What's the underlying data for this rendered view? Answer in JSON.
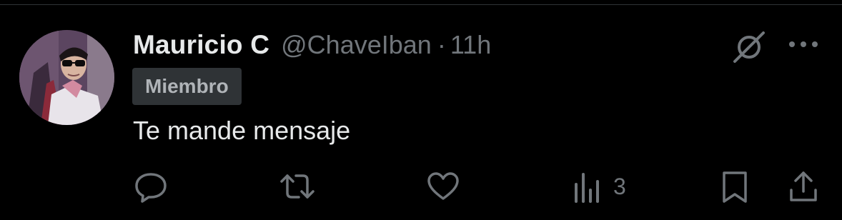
{
  "tweet": {
    "display_name": "Mauricio C",
    "handle": "@ChaveIban",
    "separator": "·",
    "time": "11h",
    "badge": "Miembro",
    "text": "Te mande mensaje"
  },
  "actions": {
    "reply_icon": "reply-icon",
    "repost_icon": "repost-icon",
    "like_icon": "heart-icon",
    "views_icon": "analytics-icon",
    "views_count": "3",
    "bookmark_icon": "bookmark-icon",
    "share_icon": "share-icon"
  },
  "header_icons": {
    "grok": "grok-icon",
    "more": "more-icon"
  },
  "colors": {
    "background": "#000000",
    "primary_text": "#e7e9ea",
    "secondary_text": "#71767b",
    "badge_background": "#2f3336"
  }
}
